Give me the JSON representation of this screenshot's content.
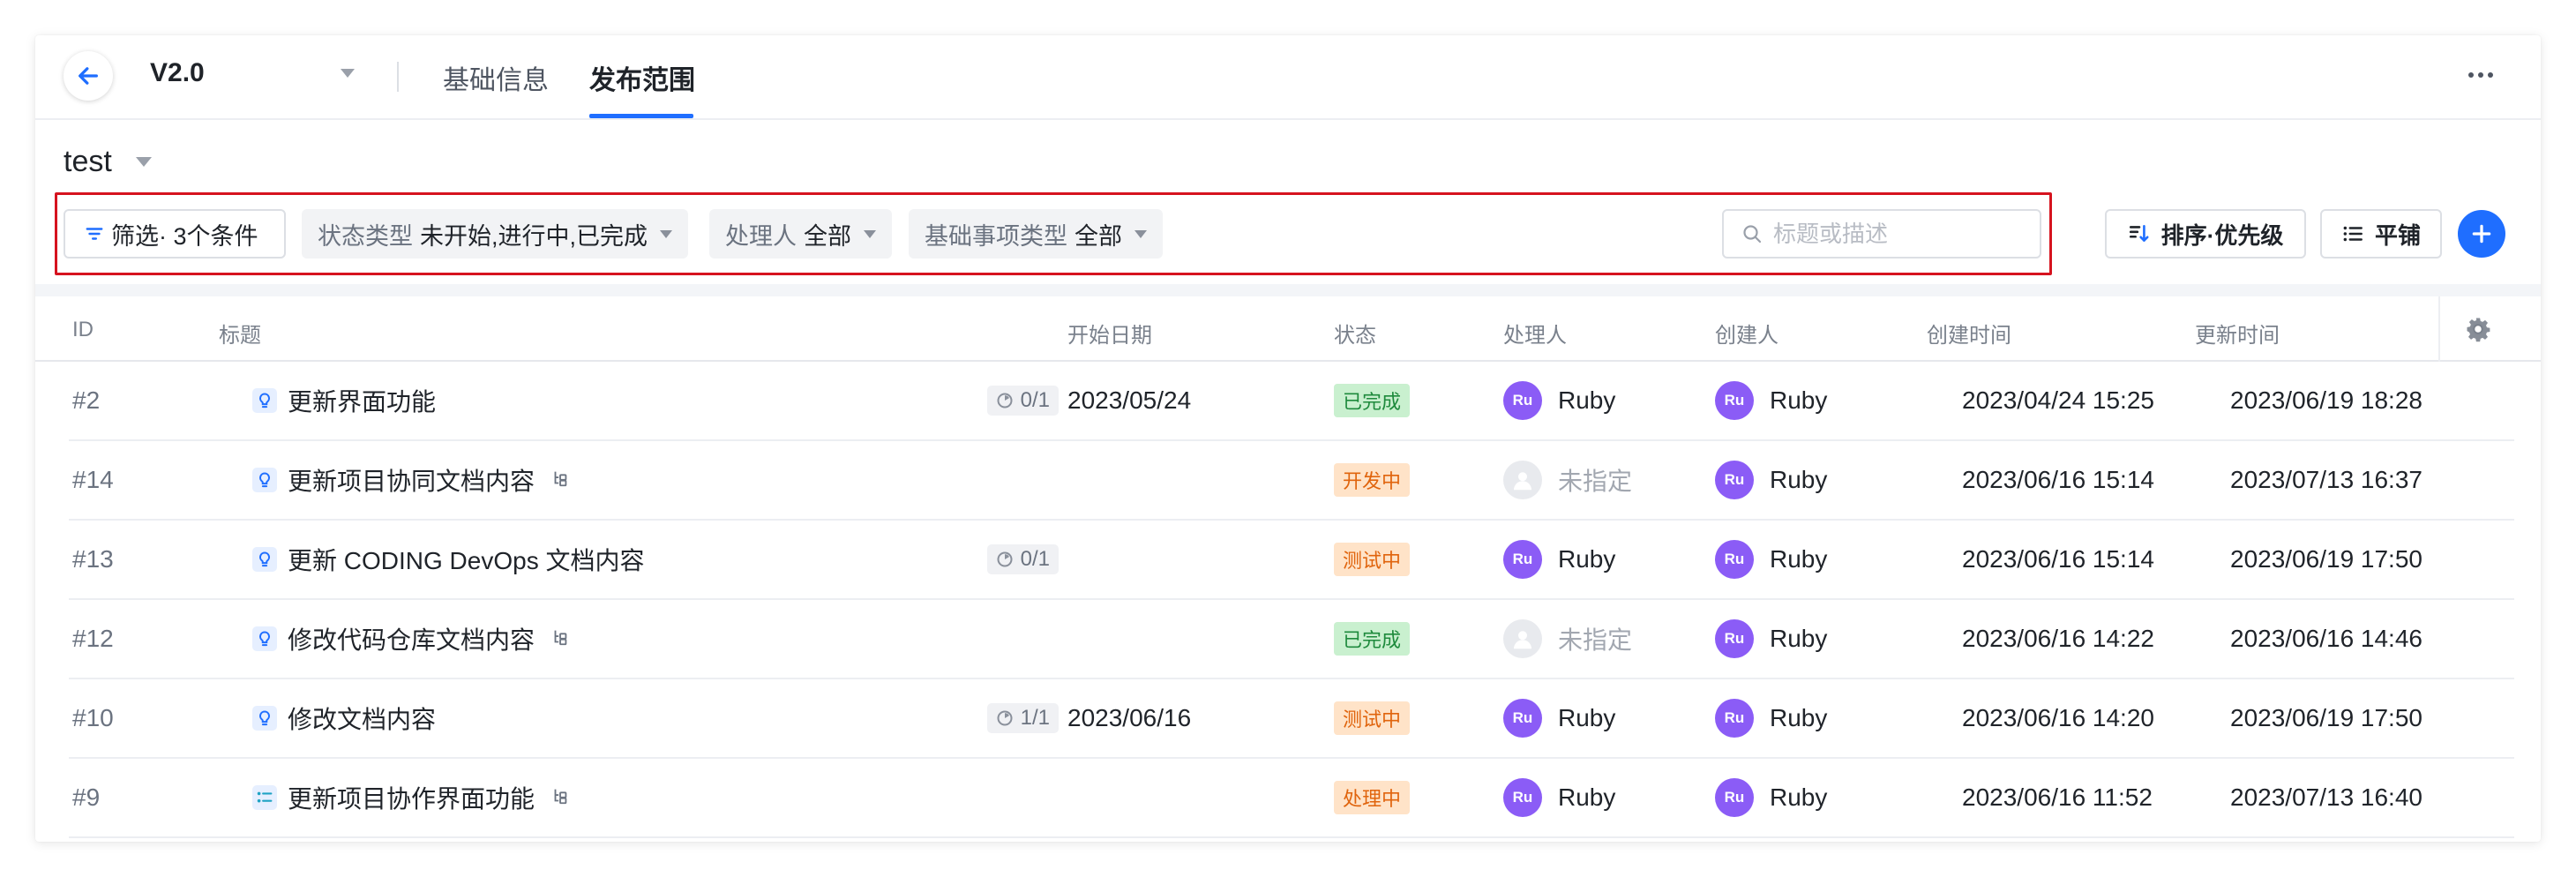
{
  "header": {
    "version": "V2.0",
    "tabs": [
      {
        "label": "基础信息",
        "active": false
      },
      {
        "label": "发布范围",
        "active": true
      }
    ]
  },
  "page": {
    "title": "test"
  },
  "filters": {
    "filter_button": "筛选· 3个条件",
    "chips": [
      {
        "key": "状态类型",
        "value": "未开始,进行中,已完成"
      },
      {
        "key": "处理人",
        "value": "全部"
      },
      {
        "key": "基础事项类型",
        "value": "全部"
      }
    ],
    "search_placeholder": "标题或描述"
  },
  "toolbar": {
    "sort_label": "排序·优先级",
    "layout_label": "平铺"
  },
  "table": {
    "columns": [
      "ID",
      "标题",
      "开始日期",
      "状态",
      "处理人",
      "创建人",
      "创建时间",
      "更新时间"
    ],
    "rows": [
      {
        "id": "#2",
        "title": "更新界面功能",
        "type": "requirement",
        "progress": "0/1",
        "sub": false,
        "start": "2023/05/24",
        "status": "已完成",
        "assignee": "Ruby",
        "assignee_initials": "Ru",
        "creator": "Ruby",
        "creator_initials": "Ru",
        "created": "2023/04/24 15:25",
        "updated": "2023/06/19 18:28"
      },
      {
        "id": "#14",
        "title": "更新项目协同文档内容",
        "type": "requirement",
        "progress": "",
        "sub": true,
        "start": "",
        "status": "开发中",
        "assignee": "未指定",
        "assignee_initials": "",
        "creator": "Ruby",
        "creator_initials": "Ru",
        "created": "2023/06/16 15:14",
        "updated": "2023/07/13 16:37"
      },
      {
        "id": "#13",
        "title": "更新 CODING DevOps 文档内容",
        "type": "requirement",
        "progress": "0/1",
        "sub": false,
        "start": "",
        "status": "测试中",
        "assignee": "Ruby",
        "assignee_initials": "Ru",
        "creator": "Ruby",
        "creator_initials": "Ru",
        "created": "2023/06/16 15:14",
        "updated": "2023/06/19 17:50"
      },
      {
        "id": "#12",
        "title": "修改代码仓库文档内容",
        "type": "requirement",
        "progress": "",
        "sub": true,
        "start": "",
        "status": "已完成",
        "assignee": "未指定",
        "assignee_initials": "",
        "creator": "Ruby",
        "creator_initials": "Ru",
        "created": "2023/06/16 14:22",
        "updated": "2023/06/16 14:46"
      },
      {
        "id": "#10",
        "title": "修改文档内容",
        "type": "requirement",
        "progress": "1/1",
        "sub": false,
        "start": "2023/06/16",
        "status": "测试中",
        "assignee": "Ruby",
        "assignee_initials": "Ru",
        "creator": "Ruby",
        "creator_initials": "Ru",
        "created": "2023/06/16 14:20",
        "updated": "2023/06/19 17:50"
      },
      {
        "id": "#9",
        "title": "更新项目协作界面功能",
        "type": "task",
        "progress": "",
        "sub": true,
        "start": "",
        "status": "处理中",
        "assignee": "Ruby",
        "assignee_initials": "Ru",
        "creator": "Ruby",
        "creator_initials": "Ru",
        "created": "2023/06/16 11:52",
        "updated": "2023/07/13 16:40"
      }
    ]
  },
  "colors": {
    "accent": "#1f6eff",
    "highlight_border": "#d6131f",
    "avatar": "#8b5cf6",
    "status": {
      "已完成": {
        "bg": "#c9f0cf",
        "fg": "#1e8a3c"
      },
      "开发中": {
        "bg": "#ffe3c8",
        "fg": "#e0640d"
      },
      "测试中": {
        "bg": "#ffe3c8",
        "fg": "#e0640d"
      },
      "处理中": {
        "bg": "#ffe3c8",
        "fg": "#e0640d"
      }
    }
  },
  "icons": {
    "back": "arrow-left-icon",
    "more": "more-horizontal-icon",
    "filter": "filter-icon",
    "search": "search-icon",
    "sort": "sort-icon",
    "layout": "list-icon",
    "add": "plus-icon",
    "settings": "gear-icon",
    "requirement": "lightbulb-icon",
    "task": "checklist-icon",
    "subtask": "subtask-icon",
    "progress": "progress-icon"
  }
}
